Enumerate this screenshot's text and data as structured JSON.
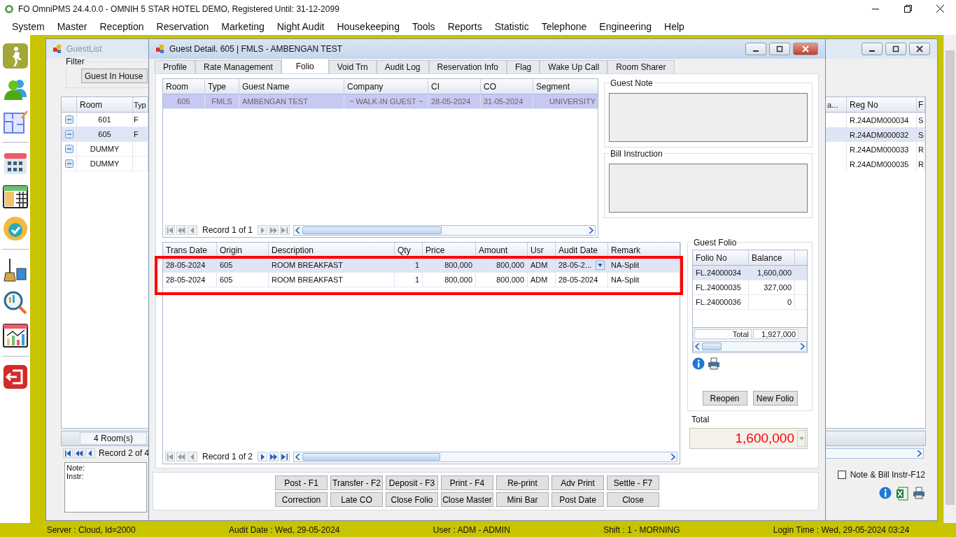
{
  "app": {
    "title": "FO OmniPMS 24.4.0.0 - OMNIH 5 STAR HOTEL DEMO, Registered Until: 31-12-2099"
  },
  "menu": [
    "System",
    "Master",
    "Reception",
    "Reservation",
    "Marketing",
    "Night Audit",
    "Housekeeping",
    "Tools",
    "Reports",
    "Statistic",
    "Telephone",
    "Engineering",
    "Help"
  ],
  "toolbar": [
    {
      "kind": "walk"
    },
    {
      "kind": "people"
    },
    {
      "kind": "plan"
    },
    {
      "kind": "calendar"
    },
    {
      "kind": "year"
    },
    {
      "kind": "check"
    },
    {
      "kind": "clean"
    },
    {
      "kind": "search"
    },
    {
      "kind": "chart"
    },
    {
      "kind": "exit"
    }
  ],
  "guest_list": {
    "title": "GuestList",
    "filter_label": "Filter",
    "filter_value": "Guest In House",
    "columns": [
      "Room",
      "Typ",
      "a...",
      "Reg No",
      "F"
    ],
    "rows": [
      {
        "room": "601",
        "type": "F",
        "reg_no": "R.24ADM000034",
        "column_5": "S",
        "selected": false
      },
      {
        "room": "605",
        "type": "F",
        "reg_no": "R.24ADM000032",
        "column_5": "S",
        "selected": true
      },
      {
        "room": "DUMMY",
        "reg_no": "R.24ADM000033",
        "column_5": "R",
        "selected": false
      },
      {
        "room": "DUMMY",
        "reg_no": "R.24ADM000035",
        "column_5": "R",
        "selected": false
      }
    ],
    "count": "4 Room(s)",
    "record": "Record 2 of 4",
    "note_label": "Note:",
    "instr_label": "Instr:",
    "note_checkbox": {
      "label": "Note & Bill Instr-F12",
      "checked": false
    }
  },
  "guest_detail": {
    "title": "Guest Detail. 605 | FMLS - AMBENGAN TEST",
    "tabs": [
      {
        "label": "Profile",
        "selected": false
      },
      {
        "label": "Rate Management",
        "selected": false
      },
      {
        "label": "Folio",
        "selected": true
      },
      {
        "label": "Void Trn",
        "selected": false
      },
      {
        "label": "Audit Log",
        "selected": false
      },
      {
        "label": "Reservation Info",
        "selected": false
      },
      {
        "label": "Flag",
        "selected": false
      },
      {
        "label": "Wake Up Call",
        "selected": false
      },
      {
        "label": "Room Sharer",
        "selected": false
      }
    ],
    "stay_grid": {
      "columns": [
        "Room",
        "Type",
        "Guest Name",
        "Company",
        "CI",
        "CO",
        "Segment"
      ],
      "rows": [
        {
          "cells": [
            "605",
            "FMLS",
            "AMBENGAN TEST",
            "~ WALK-IN GUEST ~",
            "28-05-2024",
            "31-05-2024",
            "UNIVERSITY"
          ],
          "selected": true
        }
      ],
      "record": "Record 1 of 1"
    },
    "guest_note_label": "Guest Note",
    "bill_instruction_label": "Bill Instruction",
    "transactions": {
      "columns": [
        "Trans Date",
        "Origin",
        "Description",
        "Qty",
        "Price",
        "Amount",
        "Usr",
        "Audit Date",
        "Remark"
      ],
      "rows": [
        {
          "cells": [
            "28-05-2024",
            "605",
            "ROOM BREAKFAST",
            "1",
            "800,000",
            "800,000",
            "ADM",
            "28-05-2...",
            "NA-Split"
          ],
          "selected": true,
          "editing": true
        },
        {
          "cells": [
            "28-05-2024",
            "605",
            "ROOM BREAKFAST",
            "1",
            "800,000",
            "800,000",
            "ADM",
            "28-05-2024",
            "NA-Split"
          ],
          "selected": false,
          "editing": false
        }
      ],
      "record": "Record 1 of 2"
    },
    "guest_folio": {
      "label": "Guest Folio",
      "columns": [
        "Folio No",
        "Balance"
      ],
      "rows": [
        {
          "folio_no": "FL.24000034",
          "balance": "1,600,000",
          "selected": true
        },
        {
          "folio_no": "FL.24000035",
          "balance": "327,000",
          "selected": false
        },
        {
          "folio_no": "FL.24000036",
          "balance": "0",
          "selected": false
        }
      ],
      "total_label": "Total",
      "total": "1,927,000",
      "buttons": [
        "Reopen",
        "New Folio"
      ]
    },
    "total_label": "Total",
    "total_value": "1,600,000",
    "buttons": [
      [
        "Post - F1",
        "Transfer - F2",
        "Deposit - F3",
        "Print - F4",
        "Re-print",
        "Adv Print",
        "Settle - F7"
      ],
      [
        "Correction",
        "Late CO",
        "Close Folio",
        "Close Master",
        "Mini Bar",
        "Post Date",
        "Close"
      ]
    ]
  },
  "status_bar": [
    "Server : Cloud, Id=2000",
    "Audit Date : Wed, 29-05-2024",
    "User : ADM - ADMIN",
    "Shift : 1 - MORNING",
    "Login Time : Wed, 29-05-2024 03:24"
  ]
}
